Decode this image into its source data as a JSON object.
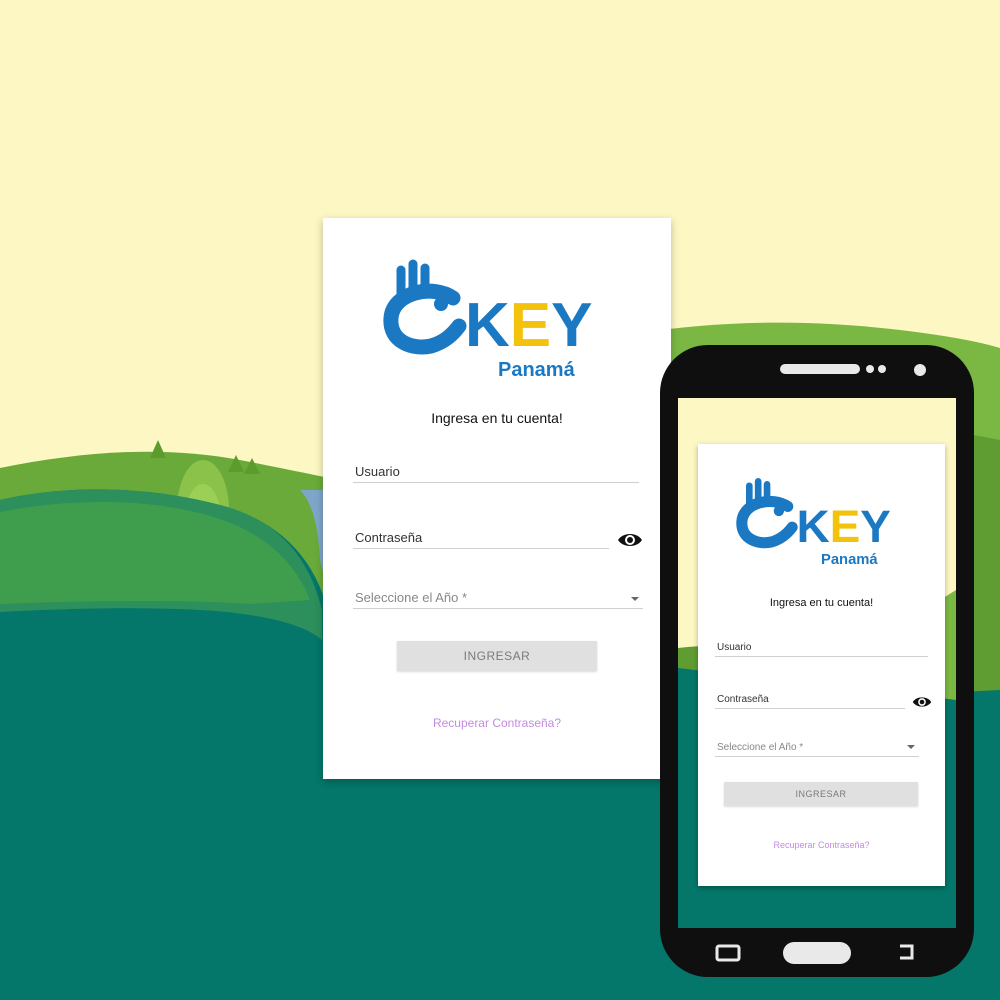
{
  "brand": {
    "logo_text": "KEY",
    "region": "Panamá"
  },
  "desktop_login": {
    "heading": "Ingresa en tu cuenta!",
    "username_label": "Usuario",
    "password_label": "Contraseña",
    "year_select_label": "Seleccione el Año *",
    "submit_label": "INGRESAR",
    "recover_link": "Recuperar Contraseña?"
  },
  "mobile_login": {
    "heading": "Ingresa en tu cuenta!",
    "username_label": "Usuario",
    "password_label": "Contraseña",
    "year_select_label": "Seleccione el Año *",
    "submit_label": "INGRESAR",
    "recover_link": "Recuperar Contraseña?"
  },
  "colors": {
    "sky": "#fdf7c3",
    "hill_light": "#6fae3a",
    "hill_dark": "#04776a",
    "logo_blue": "#1b79c4",
    "logo_yellow": "#f2c20c",
    "link": "#c58be0",
    "phone": "#0f0f0f"
  }
}
